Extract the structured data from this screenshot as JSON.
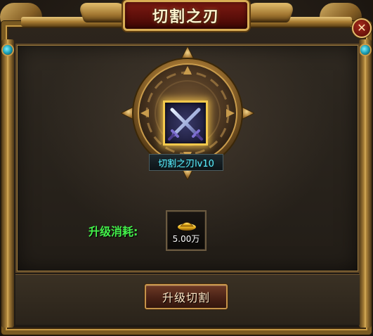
{
  "window": {
    "title": "切割之刃"
  },
  "skill": {
    "name": "切割之刃lv10",
    "icon": "crossed-swords-icon"
  },
  "cost": {
    "label": "升级消耗:",
    "amount": "5.00万",
    "icon": "gold-ingot-icon"
  },
  "actions": {
    "upgrade_label": "升级切割"
  },
  "colors": {
    "skill_name": "#5ef1ff",
    "cost_label": "#43f04a",
    "frame_gold": "#c79a45",
    "title_plaque": "#7d1a12"
  }
}
